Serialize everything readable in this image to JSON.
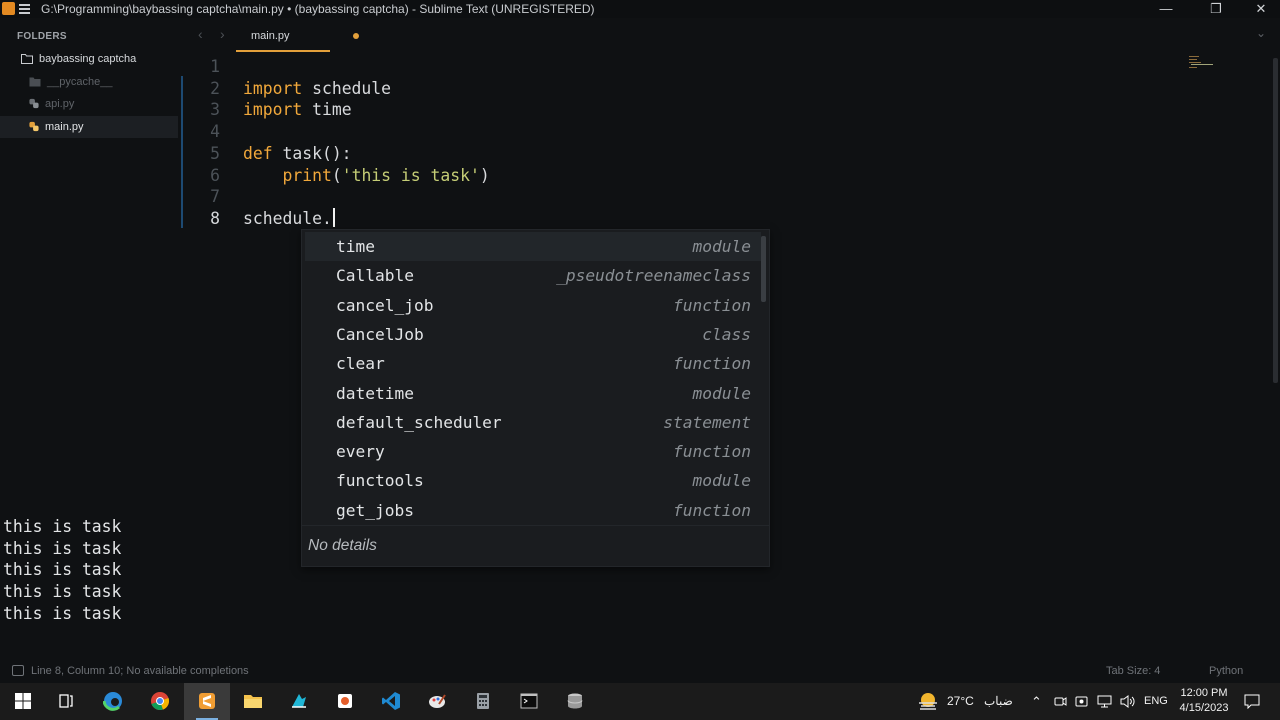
{
  "window": {
    "title": "G:\\Programming\\baybassing captcha\\main.py • (baybassing captcha) - Sublime Text (UNREGISTERED)",
    "min_glyph": "—",
    "max_glyph": "❐",
    "close_glyph": "✕"
  },
  "sidebar": {
    "header": "FOLDERS",
    "items": [
      {
        "label": "baybassing captcha",
        "icon": "folder-icon"
      },
      {
        "label": "__pycache__",
        "icon": "folder-icon"
      },
      {
        "label": "api.py",
        "icon": "python-file-icon"
      },
      {
        "label": "main.py",
        "icon": "python-file-icon"
      }
    ]
  },
  "tabs": {
    "back": "‹",
    "forward": "›",
    "items": [
      {
        "label": "main.py",
        "modified": true
      }
    ],
    "overflow": "⌄"
  },
  "editor": {
    "current_line": 8,
    "lines": [
      {
        "n": "1",
        "parts": []
      },
      {
        "n": "2",
        "parts": [
          {
            "t": "import",
            "c": "kw"
          },
          {
            "t": " schedule",
            "c": ""
          }
        ]
      },
      {
        "n": "3",
        "parts": [
          {
            "t": "import",
            "c": "kw"
          },
          {
            "t": " time",
            "c": ""
          }
        ]
      },
      {
        "n": "4",
        "parts": []
      },
      {
        "n": "5",
        "parts": [
          {
            "t": "def",
            "c": "kw"
          },
          {
            "t": " task():",
            "c": ""
          }
        ]
      },
      {
        "n": "6",
        "parts": [
          {
            "t": "    ",
            "c": ""
          },
          {
            "t": "print",
            "c": "bi"
          },
          {
            "t": "(",
            "c": ""
          },
          {
            "t": "'this is task'",
            "c": "str"
          },
          {
            "t": ")",
            "c": ""
          }
        ]
      },
      {
        "n": "7",
        "parts": []
      },
      {
        "n": "8",
        "parts": [
          {
            "t": "schedule.",
            "c": ""
          }
        ]
      }
    ]
  },
  "autocomplete": {
    "items": [
      {
        "name": "time",
        "kind": "module"
      },
      {
        "name": "Callable",
        "kind": "_pseudotreenameclass"
      },
      {
        "name": "cancel_job",
        "kind": "function"
      },
      {
        "name": "CancelJob",
        "kind": "class"
      },
      {
        "name": "clear",
        "kind": "function"
      },
      {
        "name": "datetime",
        "kind": "module"
      },
      {
        "name": "default_scheduler",
        "kind": "statement"
      },
      {
        "name": "every",
        "kind": "function"
      },
      {
        "name": "functools",
        "kind": "module"
      },
      {
        "name": "get_jobs",
        "kind": "function"
      }
    ],
    "detail": "No details"
  },
  "output": [
    "this is task",
    "this is task",
    "this is task",
    "this is task",
    "this is task"
  ],
  "status": {
    "message": "Line 8, Column 10; No available completions",
    "tab_size": "Tab Size: 4",
    "syntax": "Python"
  },
  "taskbar": {
    "apps": [
      "windows-start-icon",
      "task-view-icon",
      "edge-icon",
      "chrome-icon",
      "sublime-text-icon",
      "file-explorer-icon",
      "sparkle-app-icon",
      "office-app-icon",
      "vscode-icon",
      "paint-app-icon",
      "calculator-icon",
      "terminal-icon",
      "database-icon"
    ],
    "weather": "27°C",
    "weather_desc": "ضباب",
    "language": "ENG",
    "time": "12:00 PM",
    "date": "4/15/2023",
    "colors": {
      "accent": "#e3a03b",
      "taskbar": "#1b1b1b"
    }
  }
}
